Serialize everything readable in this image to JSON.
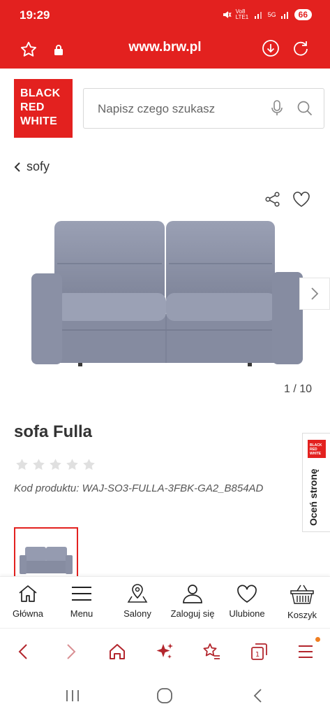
{
  "status": {
    "time": "19:29",
    "network1": "Vo8 LTE1",
    "network2": "5G",
    "battery": "66"
  },
  "browser": {
    "url": "www.brw.pl"
  },
  "header": {
    "logo_lines": [
      "BLACK",
      "RED",
      "WHITE"
    ],
    "search_placeholder": "Napisz czego szukasz"
  },
  "breadcrumb": {
    "label": "sofy"
  },
  "gallery": {
    "counter": "1 / 10"
  },
  "product": {
    "title": "sofa Fulla",
    "rating": 0,
    "rating_max": 5,
    "code": "Kod produktu: WAJ-SO3-FULLA-3FBK-GA2_B854AD"
  },
  "rate_tab": {
    "logo": "BLACK RED WHITE",
    "label": "Oceń stronę"
  },
  "site_nav": {
    "items": [
      {
        "label": "Główna",
        "icon": "home-icon"
      },
      {
        "label": "Menu",
        "icon": "hamburger-icon"
      },
      {
        "label": "Salony",
        "icon": "map-pin-icon"
      },
      {
        "label": "Zaloguj się",
        "icon": "user-icon"
      },
      {
        "label": "Ulubione",
        "icon": "heart-icon"
      },
      {
        "label": "Koszyk",
        "icon": "basket-icon"
      }
    ]
  },
  "colors": {
    "brand_red": "#e3211f",
    "sofa": "#8d93a8",
    "browser_icons": "#b3262d"
  }
}
